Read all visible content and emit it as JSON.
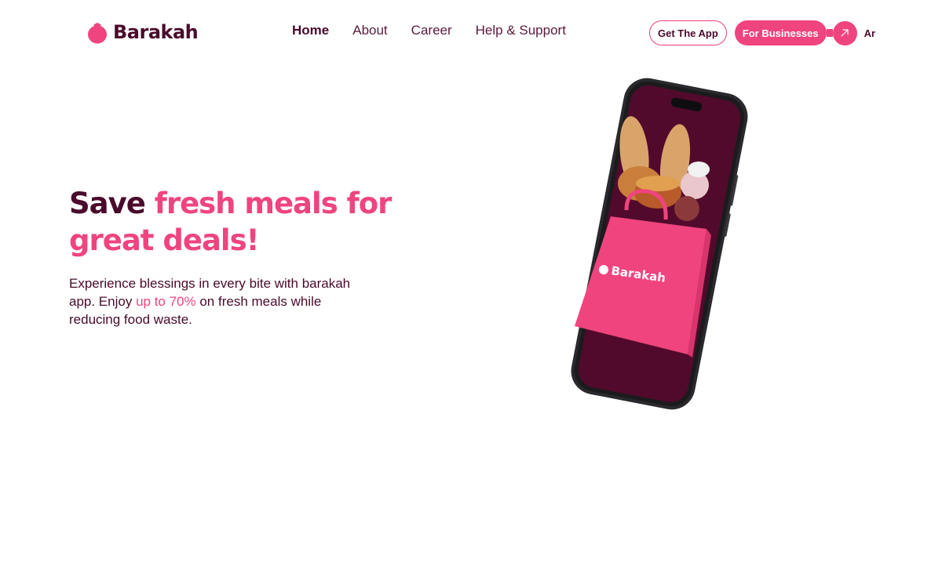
{
  "brand": {
    "name": "Barakah",
    "bag_text": "Barakah"
  },
  "nav": {
    "items": [
      {
        "label": "Home",
        "active": true
      },
      {
        "label": "About"
      },
      {
        "label": "Career"
      },
      {
        "label": "Help & Support"
      }
    ]
  },
  "header_actions": {
    "get_app": "Get The App",
    "for_businesses": "For Businesses",
    "language": "Ar",
    "arrow_icon": "arrow-up-right-icon"
  },
  "hero": {
    "title_plain": "Save ",
    "title_accent": "fresh meals for great deals!",
    "subtitle_before": "Experience blessings in every bite with barakah app. Enjoy ",
    "subtitle_accent": "up to 70%",
    "subtitle_after": " on fresh meals while reducing food waste."
  },
  "colors": {
    "brand_pink": "#f0447e",
    "brand_dark": "#4a0a2c",
    "phone_screen": "#520a2c"
  }
}
